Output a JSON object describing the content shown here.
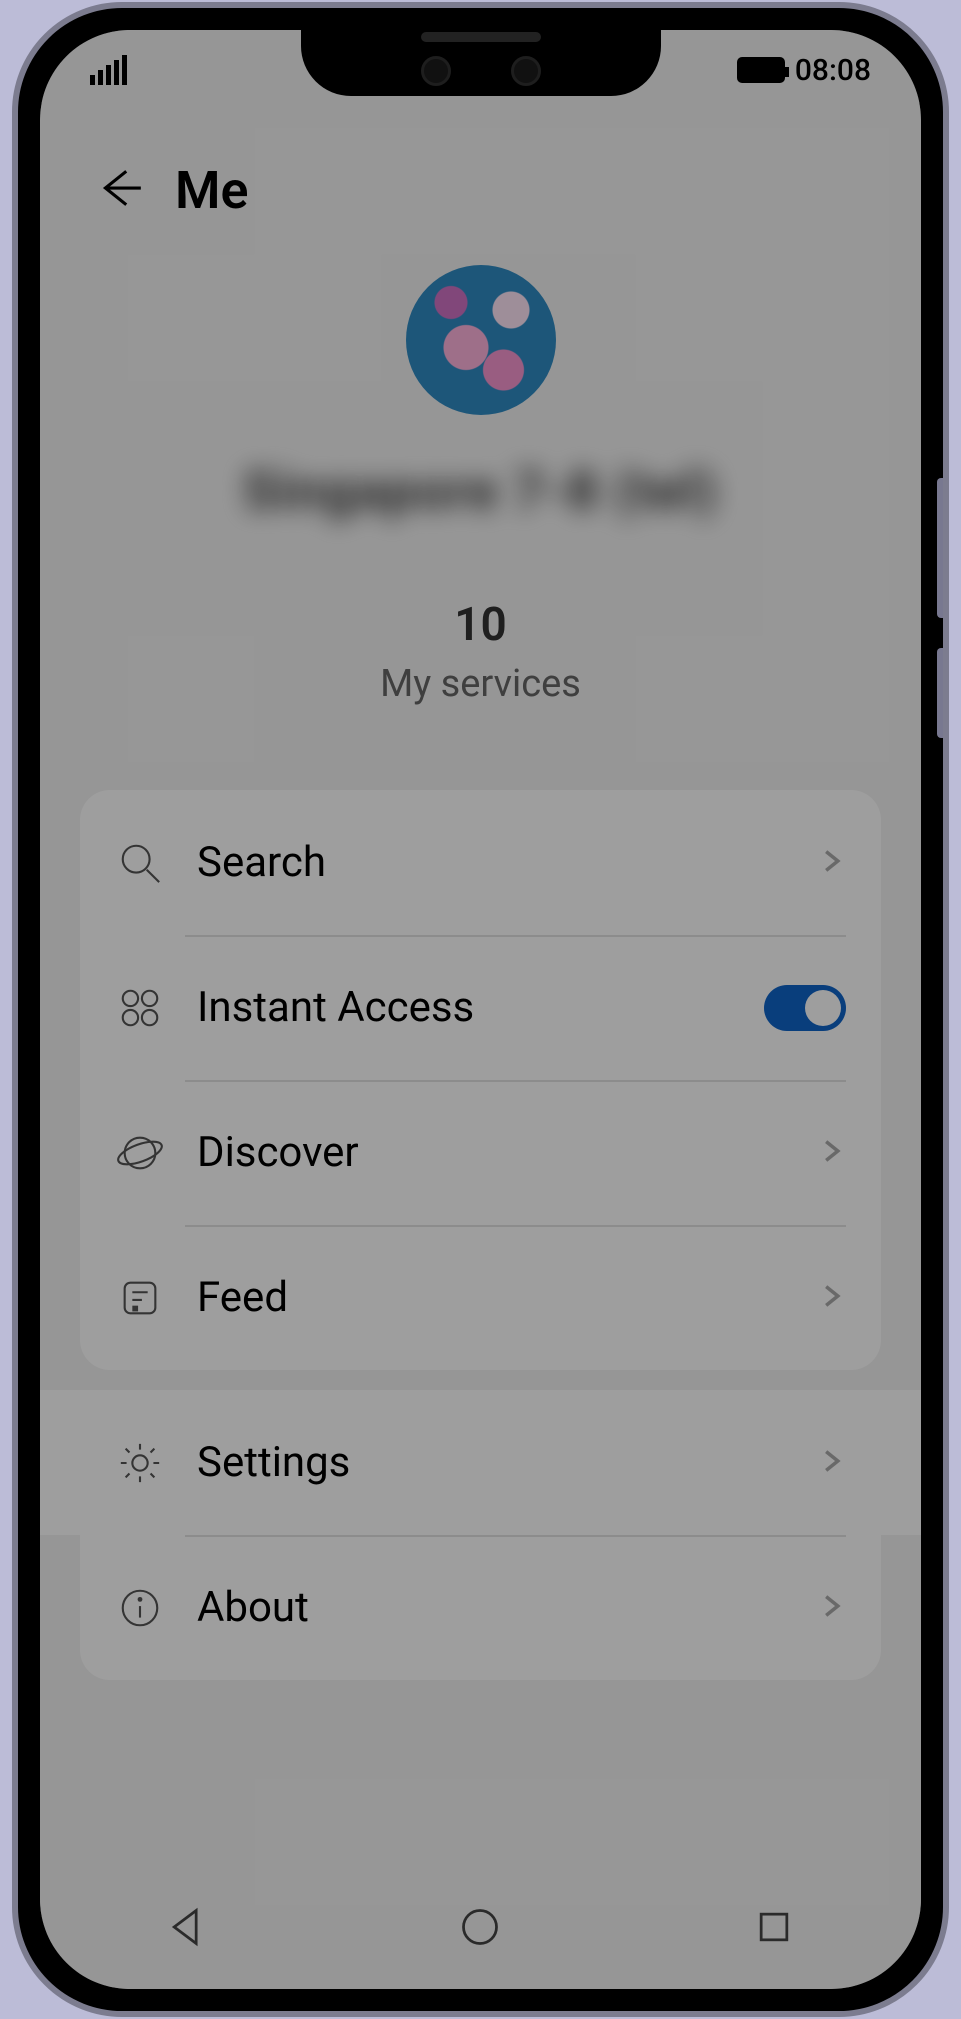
{
  "status_bar": {
    "time": "08:08"
  },
  "header": {
    "title": "Me"
  },
  "profile": {
    "username_obscured": "Singapore  7-8 (tel)",
    "services_count": "10",
    "services_label": "My services"
  },
  "card1_rows": [
    {
      "icon": "search-icon",
      "label": "Search",
      "accessory": "chevron"
    },
    {
      "icon": "grid-icon",
      "label": "Instant Access",
      "accessory": "toggle_on"
    },
    {
      "icon": "planet-icon",
      "label": "Discover",
      "accessory": "chevron"
    },
    {
      "icon": "feed-icon",
      "label": "Feed",
      "accessory": "chevron"
    }
  ],
  "card2_rows": [
    {
      "icon": "gear-icon",
      "label": "Settings",
      "accessory": "chevron",
      "highlighted": true
    },
    {
      "icon": "info-icon",
      "label": "About",
      "accessory": "chevron"
    }
  ]
}
